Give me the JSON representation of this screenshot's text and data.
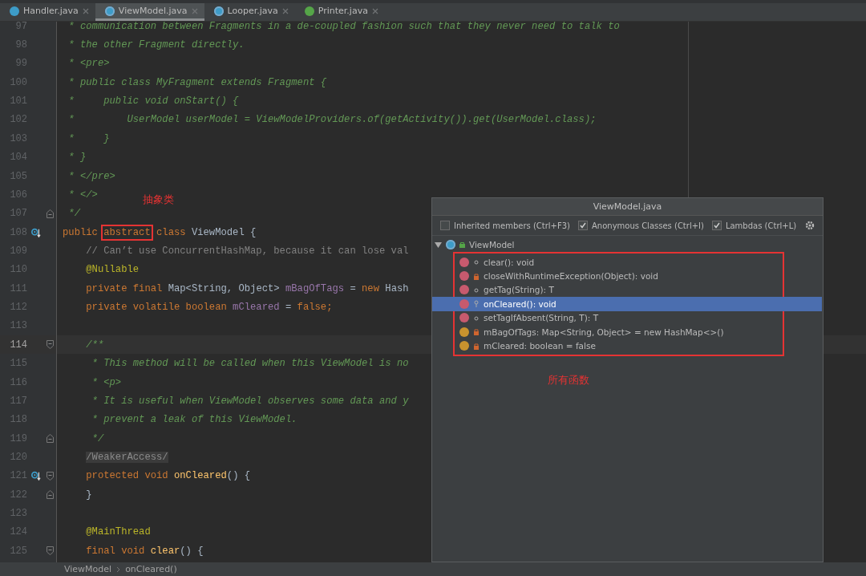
{
  "tabs": [
    {
      "label": "Handler.java",
      "kind": "class",
      "selected": false
    },
    {
      "label": "ViewModel.java",
      "kind": "abstract",
      "selected": true
    },
    {
      "label": "Looper.java",
      "kind": "abstract",
      "selected": false
    },
    {
      "label": "Printer.java",
      "kind": "interface",
      "selected": false
    }
  ],
  "lines": [
    {
      "number": "97",
      "current": false,
      "tokens": [
        {
          "text": " * communication between Fragments in a de-coupled fashion such that they never need to talk to",
          "kind": "doc"
        }
      ]
    },
    {
      "number": "98",
      "current": false,
      "tokens": [
        {
          "text": " * the other Fragment directly.",
          "kind": "doc"
        }
      ]
    },
    {
      "number": "99",
      "current": false,
      "tokens": [
        {
          "text": " * <pre>",
          "kind": "doc"
        }
      ]
    },
    {
      "number": "100",
      "current": false,
      "tokens": [
        {
          "text": " * public class MyFragment extends Fragment {",
          "kind": "doc"
        }
      ]
    },
    {
      "number": "101",
      "current": false,
      "tokens": [
        {
          "text": " *     public void onStart() {",
          "kind": "doc"
        }
      ]
    },
    {
      "number": "102",
      "current": false,
      "tokens": [
        {
          "text": " *         UserModel userModel = ViewModelProviders.of(getActivity()).get(UserModel.class);",
          "kind": "doc"
        }
      ]
    },
    {
      "number": "103",
      "current": false,
      "tokens": [
        {
          "text": " *     }",
          "kind": "doc"
        }
      ]
    },
    {
      "number": "104",
      "current": false,
      "tokens": [
        {
          "text": " * }",
          "kind": "doc"
        }
      ]
    },
    {
      "number": "105",
      "current": false,
      "tokens": [
        {
          "text": " * </pre>",
          "kind": "doc"
        }
      ]
    },
    {
      "number": "106",
      "current": false,
      "tokens": [
        {
          "text": " * </>",
          "kind": "doc"
        }
      ]
    },
    {
      "number": "107",
      "current": false,
      "fold_end": true,
      "tokens": [
        {
          "text": " */",
          "kind": "doc"
        }
      ]
    },
    {
      "number": "108",
      "current": false,
      "override": true,
      "tokens": [
        {
          "text": "public",
          "kind": "keyword"
        },
        {
          "text": "abstract",
          "kind": "keyword",
          "boxed": true
        },
        {
          "text": "class",
          "kind": "keyword"
        },
        {
          "text": "ViewModel {",
          "kind": "plain"
        }
      ]
    },
    {
      "number": "109",
      "current": false,
      "tokens": [
        {
          "text": "    // Can’t use ConcurrentHashMap, because it can lose val",
          "kind": "linecomment"
        }
      ]
    },
    {
      "number": "110",
      "current": false,
      "tokens": [
        {
          "text": "    @Nullable",
          "kind": "annotation"
        }
      ]
    },
    {
      "number": "111",
      "current": false,
      "tokens": [
        {
          "text": "    private final ",
          "kind": "keyword"
        },
        {
          "text": "Map<String, Object> ",
          "kind": "plain"
        },
        {
          "text": "mBagOfTags",
          "kind": "field"
        },
        {
          "text": " = ",
          "kind": "plain"
        },
        {
          "text": "new ",
          "kind": "keyword"
        },
        {
          "text": "Hash",
          "kind": "plain"
        }
      ]
    },
    {
      "number": "112",
      "current": false,
      "tokens": [
        {
          "text": "    private volatile boolean ",
          "kind": "keyword"
        },
        {
          "text": "mCleared",
          "kind": "field"
        },
        {
          "text": " = ",
          "kind": "plain"
        },
        {
          "text": "false;",
          "kind": "keyword"
        }
      ]
    },
    {
      "number": "113",
      "current": false
    },
    {
      "number": "114",
      "current": true,
      "fold_start": true,
      "tokens": [
        {
          "text": "    /**",
          "kind": "doc"
        }
      ]
    },
    {
      "number": "115",
      "current": false,
      "tokens": [
        {
          "text": "     * This method will be called when this ViewModel is no",
          "kind": "doc"
        }
      ]
    },
    {
      "number": "116",
      "current": false,
      "tokens": [
        {
          "text": "     * <p>",
          "kind": "doc"
        }
      ]
    },
    {
      "number": "117",
      "current": false,
      "tokens": [
        {
          "text": "     * It is useful when ViewModel observes some data and y",
          "kind": "doc"
        }
      ]
    },
    {
      "number": "118",
      "current": false,
      "tokens": [
        {
          "text": "     * prevent a leak of this ViewModel.",
          "kind": "doc"
        }
      ]
    },
    {
      "number": "119",
      "current": false,
      "fold_end": true,
      "tokens": [
        {
          "text": "     */",
          "kind": "doc"
        }
      ]
    },
    {
      "number": "120",
      "current": false,
      "tokens": [
        {
          "text": "    /WeakerAccess/",
          "kind": "suppressed"
        }
      ]
    },
    {
      "number": "121",
      "current": false,
      "override": true,
      "fold_start": true,
      "tokens": [
        {
          "text": "    protected void ",
          "kind": "keyword"
        },
        {
          "text": "onCleared",
          "kind": "method"
        },
        {
          "text": "() {",
          "kind": "plain"
        }
      ]
    },
    {
      "number": "122",
      "current": false,
      "fold_end": true,
      "tokens": [
        {
          "text": "    }",
          "kind": "plain"
        }
      ]
    },
    {
      "number": "123",
      "current": false
    },
    {
      "number": "124",
      "current": false,
      "tokens": [
        {
          "text": "    @MainThread",
          "kind": "annotation"
        }
      ]
    },
    {
      "number": "125",
      "current": false,
      "fold_start": true,
      "tokens": [
        {
          "text": "    final void ",
          "kind": "keyword"
        },
        {
          "text": "clear",
          "kind": "method"
        },
        {
          "text": "() {",
          "kind": "plain"
        }
      ]
    }
  ],
  "notes": [
    {
      "text": "抽象类",
      "kind": "abstract-note"
    },
    {
      "text": "所有函数",
      "kind": "members-note"
    }
  ],
  "structure_popup": {
    "title": "ViewModel.java",
    "options": [
      {
        "label": "Inherited members (Ctrl+F3)",
        "checked": false
      },
      {
        "label": "Anonymous Classes (Ctrl+I)",
        "checked": true
      },
      {
        "label": "Lambdas (Ctrl+L)",
        "checked": true
      }
    ],
    "root": {
      "label": "ViewModel",
      "expanded": true
    },
    "members": [
      {
        "label": "clear(): void",
        "kind": "method",
        "private": false,
        "protected": false,
        "selected": false
      },
      {
        "label": "closeWithRuntimeException(Object): void",
        "kind": "method",
        "private": true,
        "protected": false,
        "selected": false
      },
      {
        "label": "getTag(String): T",
        "kind": "method",
        "private": false,
        "protected": false,
        "selected": false
      },
      {
        "label": "onCleared(): void",
        "kind": "method",
        "private": false,
        "protected": true,
        "selected": true
      },
      {
        "label": "setTagIfAbsent(String, T): T",
        "kind": "method",
        "private": false,
        "protected": false,
        "selected": false
      },
      {
        "label": "mBagOfTags: Map<String, Object> = new HashMap<>()",
        "kind": "field",
        "private": true,
        "protected": false,
        "selected": false
      },
      {
        "label": "mCleared: boolean = false",
        "kind": "field",
        "private": true,
        "protected": false,
        "selected": false
      }
    ]
  },
  "breadcrumb": [
    "ViewModel",
    "onCleared()"
  ]
}
